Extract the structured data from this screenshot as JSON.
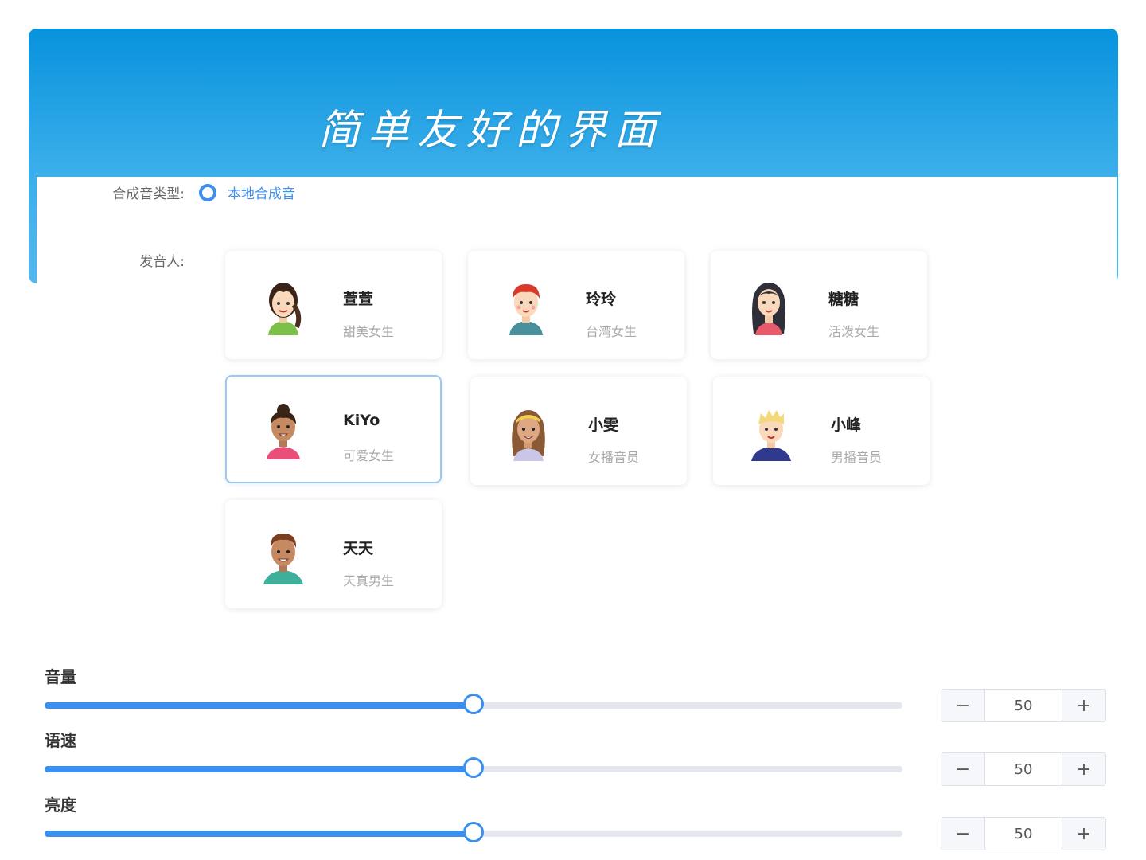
{
  "header": {
    "title": "简单友好的界面"
  },
  "form": {
    "synthesis_type_label": "合成音类型:",
    "synthesis_option": "本地合成音",
    "speaker_label": "发音人:"
  },
  "speakers": [
    {
      "name": "萱萱",
      "desc": "甜美女生",
      "selected": false
    },
    {
      "name": "玲玲",
      "desc": "台湾女生",
      "selected": false
    },
    {
      "name": "糖糖",
      "desc": "活泼女生",
      "selected": false
    },
    {
      "name": "KiYo",
      "desc": "可爱女生",
      "selected": true
    },
    {
      "name": "小雯",
      "desc": "女播音员",
      "selected": false
    },
    {
      "name": "小峰",
      "desc": "男播音员",
      "selected": false
    },
    {
      "name": "天天",
      "desc": "天真男生",
      "selected": false
    }
  ],
  "sliders": [
    {
      "label": "音量",
      "value": "50",
      "fraction": 0.5
    },
    {
      "label": "语速",
      "value": "50",
      "fraction": 0.5
    },
    {
      "label": "亮度",
      "value": "50",
      "fraction": 0.5
    }
  ],
  "stepper": {
    "minus": "−",
    "plus": "+"
  },
  "colors": {
    "accent": "#3c8ff0",
    "header_top": "#0892dd",
    "header_bottom": "#55b8ee"
  }
}
